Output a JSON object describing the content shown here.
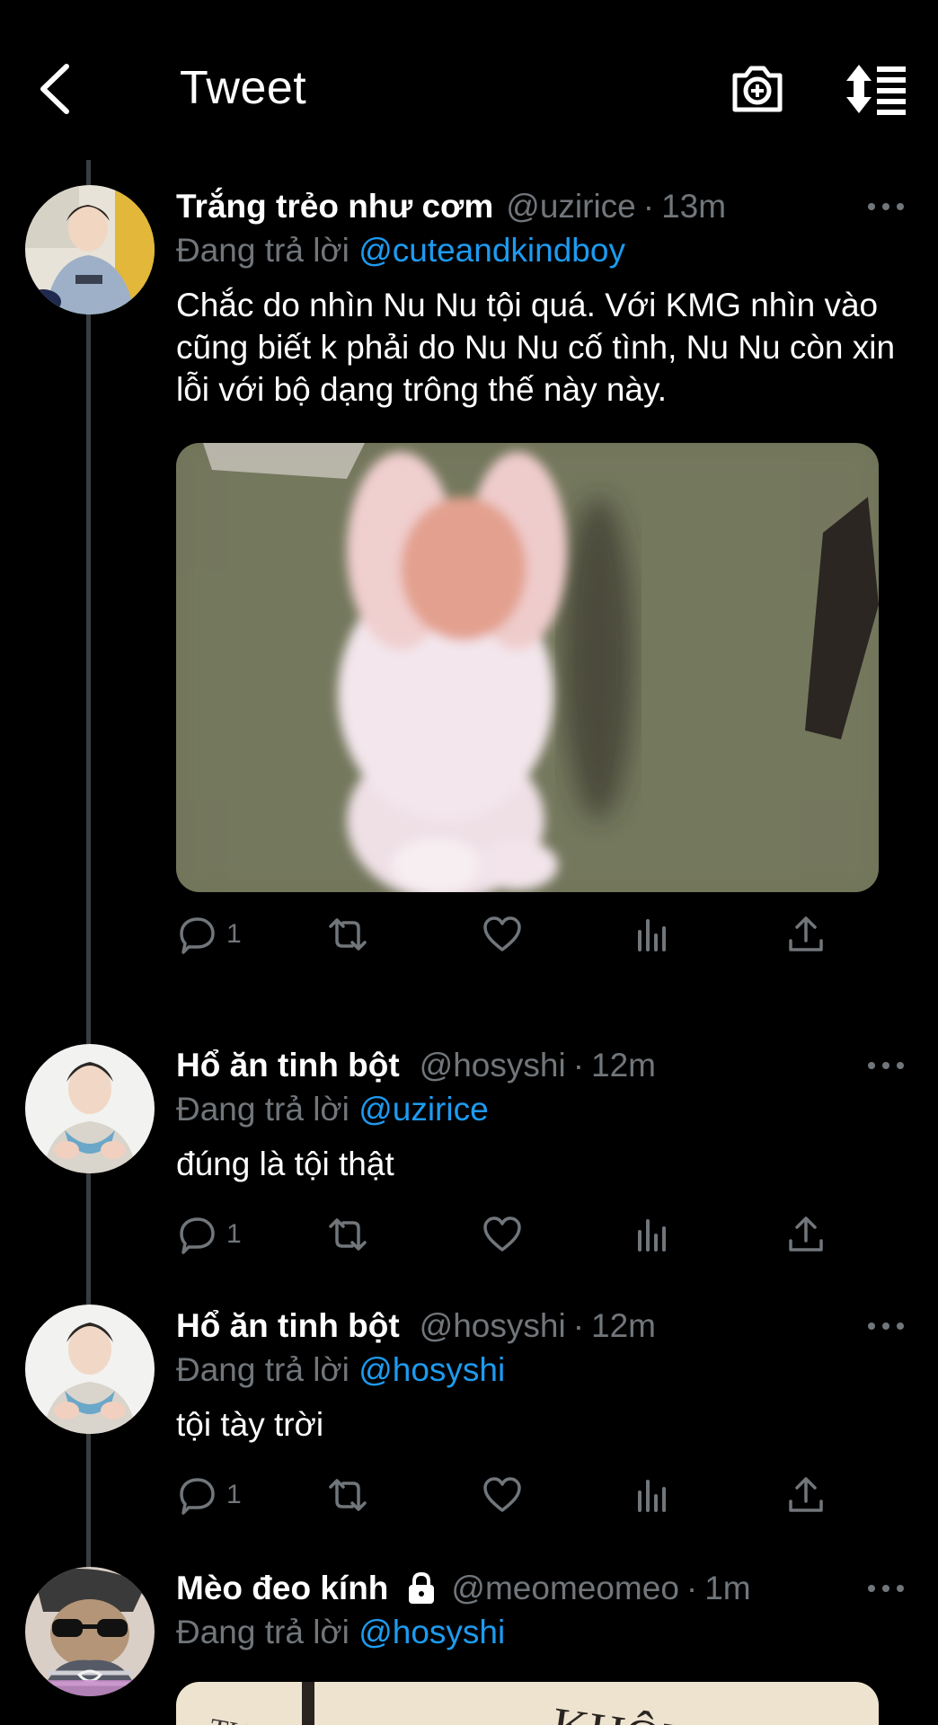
{
  "header": {
    "title": "Tweet"
  },
  "tweets": [
    {
      "name": "Trắng trẻo như cơm",
      "handle": "@uzirice",
      "time": "13m",
      "reply_prefix": "Đang trả lời",
      "reply_to": "@cuteandkindboy",
      "text": "Chắc do nhìn Nu Nu tội quá. Với KMG nhìn vào cũng biết k phải do Nu Nu cố tình, Nu Nu còn xin lỗi với bộ dạng trông thế này này.",
      "reply_count": "1"
    },
    {
      "name": "Hổ ăn tinh bột",
      "handle": "@hosyshi",
      "time": "12m",
      "reply_prefix": "Đang trả lời",
      "reply_to": "@uzirice",
      "text": "đúng là tội thật",
      "reply_count": "1"
    },
    {
      "name": "Hổ ăn tinh bột",
      "handle": "@hosyshi",
      "time": "12m",
      "reply_prefix": "Đang trả lời",
      "reply_to": "@hosyshi",
      "text": "tội tày trời",
      "reply_count": "1"
    },
    {
      "name": "Mèo đeo kính",
      "handle": "@meomeomeo",
      "time": "1m",
      "reply_prefix": "Đang trả lời",
      "reply_to": "@hosyshi",
      "media_text": "KHÔNG"
    }
  ],
  "colors": {
    "background": "#000000",
    "link": "#1d9bf0",
    "muted": "#71767b",
    "thread_line": "#3a3d40"
  },
  "icons": [
    "back-icon",
    "camera-plus-icon",
    "sort-icon",
    "more-icon",
    "reply-icon",
    "retweet-icon",
    "like-icon",
    "views-icon",
    "share-icon",
    "lock-icon"
  ]
}
